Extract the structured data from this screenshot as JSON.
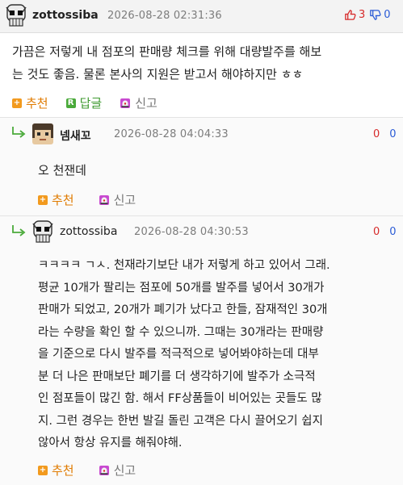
{
  "post": {
    "author": "zottossiba",
    "date": "2026-08-28 02:31:36",
    "upvotes": "3",
    "downvotes": "0",
    "text_lines": [
      "가끔은 저렇게 내 점포의 판매량 체크를 위해 대량발주를 해보",
      "는 것도 좋음. 물론 본사의 지원은 받고서 해야하지만 ㅎㅎ"
    ],
    "actions": {
      "recommend": "추천",
      "reply": "답글",
      "report": "신고"
    }
  },
  "comments": [
    {
      "author": "넴새꼬",
      "date": "2026-08-28 04:04:33",
      "upvotes": "0",
      "downvotes": "0",
      "text_lines": [
        "오 천잰데"
      ],
      "actions": {
        "recommend": "추천",
        "report": "신고"
      }
    },
    {
      "author": "zottossiba",
      "date": "2026-08-28 04:30:53",
      "upvotes": "0",
      "downvotes": "0",
      "text_lines": [
        "ㅋㅋㅋㅋ ㄱㅅ. 천재라기보단 내가 저렇게 하고 있어서 그래.",
        "평균 10개가 팔리는 점포에 50개를 발주를 넣어서 30개가",
        "판매가 되었고, 20개가 폐기가 났다고 한들, 잠재적인 30개",
        "라는 수량을 확인 할 수 있으니까. 그때는 30개라는 판매량",
        "을 기준으로 다시 발주를 적극적으로 넣어봐야하는데 대부",
        "분 더 나은 판매보단 폐기를 더 생각하기에 발주가 소극적",
        "인 점포들이 많긴 함. 해서 FF상품들이 비어있는 곳들도 많",
        "지. 그런 경우는 한번 발길 돌린 고객은 다시 끌어오기 쉽지",
        "않아서 항상 유지를 해줘야해."
      ],
      "actions": {
        "recommend": "추천",
        "report": "신고"
      }
    }
  ],
  "colors": {
    "upvote": "#d62a2a",
    "downvote": "#2a5bd6",
    "recommend": "#e07b00",
    "reply": "#3f9a30",
    "report": "#777777"
  }
}
